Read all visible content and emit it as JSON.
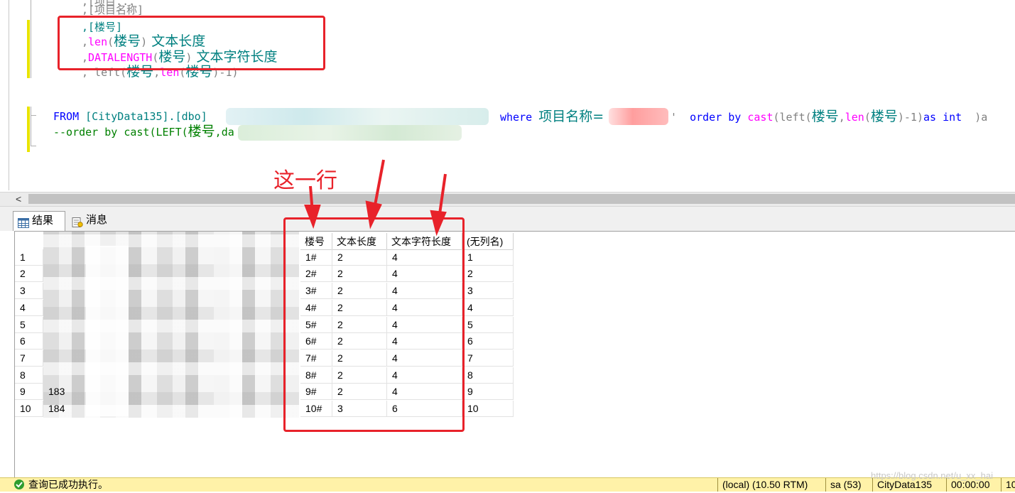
{
  "code_lines": {
    "l0": ",[项目名称]",
    "l1": ",[楼号]",
    "l2a": ",",
    "l2fn": "len",
    "l2b": "(",
    "l2c": "楼号",
    "l2d": ")",
    "l2e": " 文本长度",
    "l3a": ",",
    "l3fn": "DATALENGTH",
    "l3b": "(",
    "l3c": "楼号",
    "l3d": ")",
    "l3e": " 文本字符长度",
    "l4a": ", left(",
    "l4b": "楼号",
    "l4c": ",",
    "l4fn": "len",
    "l4d": "(",
    "l4e": "楼号",
    "l4f": ")-1)",
    "from_kw": "FROM",
    "from_tbl": "[CityData135].[dbo]",
    "where_kw": "where",
    "where_col": "项目名称=",
    "where_q": "'",
    "order_kw": "order by",
    "cast_fn": "cast",
    "order_rest_a": "(left(",
    "order_col1": "楼号",
    "order_rest_b": ",",
    "len_fn": "len",
    "order_rest_c": "(",
    "order_col2": "楼号",
    "order_rest_d": ")-1)",
    "as_kw": "as",
    "int_kw": "int",
    "tail": ")a",
    "comment_a": "--order by cast(LEFT(",
    "comment_b": "楼号",
    "comment_c": ",da"
  },
  "tabs": {
    "results": "结果",
    "messages": "消息"
  },
  "grid": {
    "headers": [
      "楼号",
      "文本长度",
      "文本字符长度",
      "(无列名)"
    ],
    "rows": [
      {
        "n": "1",
        "a": "1#",
        "b": "2",
        "c": "4",
        "d": "1"
      },
      {
        "n": "2",
        "a": "2#",
        "b": "2",
        "c": "4",
        "d": "2"
      },
      {
        "n": "3",
        "a": "3#",
        "b": "2",
        "c": "4",
        "d": "3"
      },
      {
        "n": "4",
        "a": "4#",
        "b": "2",
        "c": "4",
        "d": "4"
      },
      {
        "n": "5",
        "a": "5#",
        "b": "2",
        "c": "4",
        "d": "5"
      },
      {
        "n": "6",
        "a": "6#",
        "b": "2",
        "c": "4",
        "d": "6"
      },
      {
        "n": "7",
        "a": "7#",
        "b": "2",
        "c": "4",
        "d": "7"
      },
      {
        "n": "8",
        "a": "8#",
        "b": "2",
        "c": "4",
        "d": "8"
      },
      {
        "n": "9",
        "a": "9#",
        "b": "2",
        "c": "4",
        "d": "9"
      },
      {
        "n": "10",
        "a": "10#",
        "b": "3",
        "c": "6",
        "d": "10"
      }
    ],
    "partial_first_col": {
      "r9": "183",
      "r10": "184"
    }
  },
  "annotation": {
    "label": "这一行",
    "color": "#e8222a"
  },
  "status": {
    "message": "查询已成功执行。",
    "server": "(local) (10.50 RTM)",
    "user": "sa (53)",
    "db": "CityData135",
    "time": "00:00:00",
    "rows": "10"
  },
  "watermark": "https://blog.csdn.net/u_xx_hai"
}
